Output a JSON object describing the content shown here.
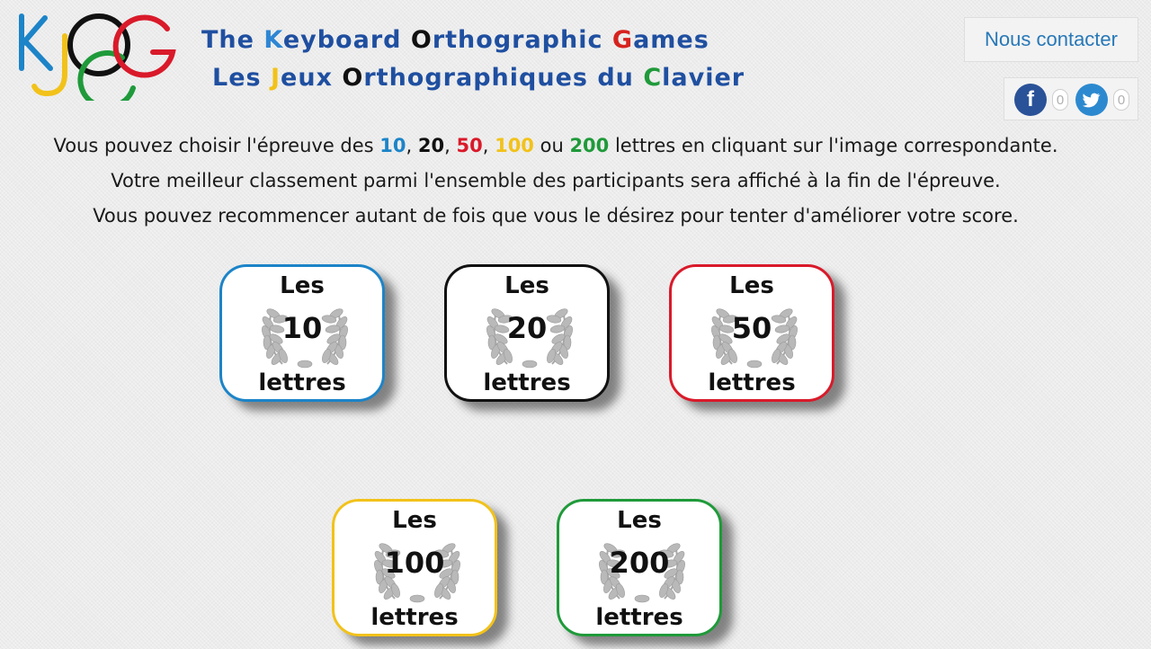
{
  "logo": {
    "alt": "KJOG"
  },
  "title": {
    "line1": [
      {
        "text": "The ",
        "color": "#1f4fa0"
      },
      {
        "text": "K",
        "color": "#2e86d3"
      },
      {
        "text": "eyboard ",
        "color": "#1f4fa0"
      },
      {
        "text": "O",
        "color": "#111111"
      },
      {
        "text": "rthographic ",
        "color": "#1f4fa0"
      },
      {
        "text": "G",
        "color": "#d6231f"
      },
      {
        "text": "ames",
        "color": "#1f4fa0"
      }
    ],
    "line2": [
      {
        "text": "Les ",
        "color": "#1f4fa0"
      },
      {
        "text": "J",
        "color": "#f2c21a"
      },
      {
        "text": "eux ",
        "color": "#1f4fa0"
      },
      {
        "text": "O",
        "color": "#111111"
      },
      {
        "text": "rthographiques du ",
        "color": "#1f4fa0"
      },
      {
        "text": "C",
        "color": "#1f9a3a"
      },
      {
        "text": "lavier",
        "color": "#1f4fa0"
      }
    ]
  },
  "contact": {
    "label": "Nous contacter"
  },
  "share": {
    "facebook_icon": "f",
    "facebook_count": "0",
    "twitter_count": "0"
  },
  "intro": {
    "line1": {
      "prefix": "Vous pouvez choisir l'épreuve des ",
      "n10": "10",
      "sep1": ", ",
      "n20": "20",
      "sep2": ", ",
      "n50": "50",
      "sep3": ", ",
      "n100": "100",
      "sep4": " ou ",
      "n200": "200",
      "suffix": " lettres en cliquant sur l'image correspondante."
    },
    "line2": "Votre meilleur classement parmi l'ensemble des participants sera affiché à la fin de l'épreuve.",
    "line3": "Vous pouvez recommencer autant de fois que vous le désirez pour tenter d'améliorer votre score."
  },
  "colors": {
    "blue": "#1c84c8",
    "black": "#111111",
    "red": "#d91a2a",
    "yellow": "#f2c21a",
    "green": "#1f9a3a",
    "title": "#1f4fa0",
    "link": "#2778b8"
  },
  "cards": [
    {
      "top": "Les",
      "number": "10",
      "bottom": "lettres",
      "color": "#1c84c8"
    },
    {
      "top": "Les",
      "number": "20",
      "bottom": "lettres",
      "color": "#111111"
    },
    {
      "top": "Les",
      "number": "50",
      "bottom": "lettres",
      "color": "#d91a2a"
    },
    {
      "top": "Les",
      "number": "100",
      "bottom": "lettres",
      "color": "#f2c21a"
    },
    {
      "top": "Les",
      "number": "200",
      "bottom": "lettres",
      "color": "#1f9a3a"
    }
  ]
}
